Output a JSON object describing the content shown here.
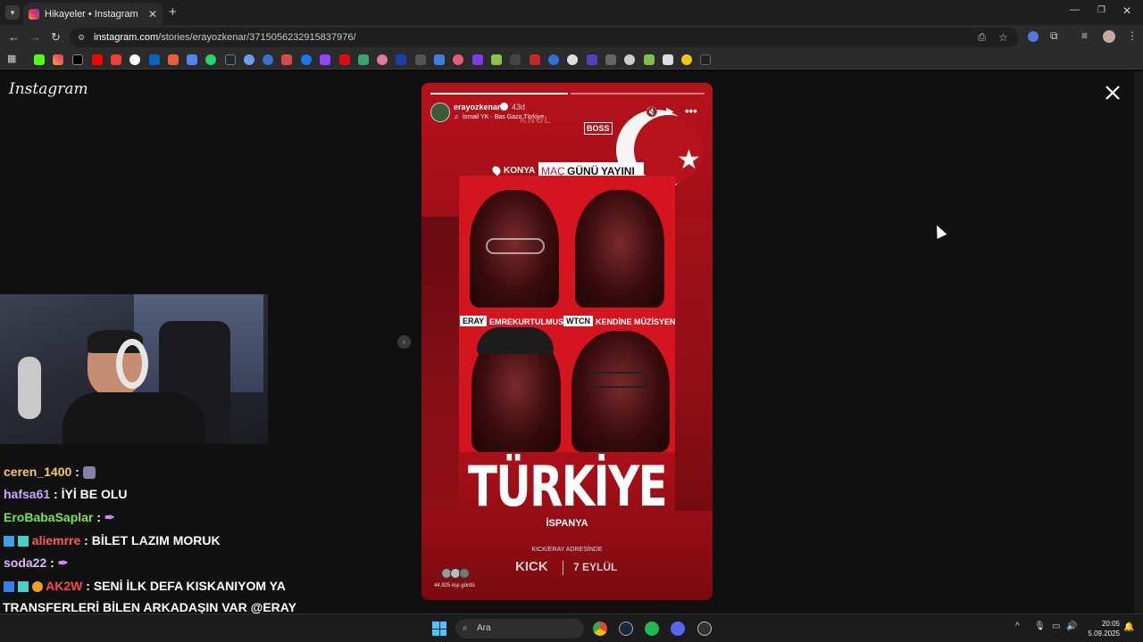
{
  "browser": {
    "tab_title": "Hikayeler • Instagram",
    "url_domain": "instagram.com",
    "url_path": "/stories/erayozkenar/3715056232915837976/"
  },
  "instagram": {
    "logo_text": "Instagram",
    "story": {
      "username": "erayozkenar",
      "age": "43d",
      "music": "İsmail YK · Bas Gaza Türkiye",
      "location_tag": "KONYA",
      "banner_word1": "MAÇ",
      "banner_word2": "GÜNÜ",
      "banner_word3": "YAYINI",
      "tag_eray": "ERAY",
      "tag_emre": "EMREKURTULMUS",
      "tag_wtcn": "WTCN",
      "tag_kendine": "KENDİNE MÜZİSYEN",
      "headline": "TÜRKİYE",
      "subheadline": "İSPANYA",
      "adres_line": "KICK/ERAY ADRESİNDE",
      "kick_label": "KICK",
      "date_label": "7 EYLÜL",
      "viewers": "44.925 kişi gördü",
      "logo_left": "KNGL",
      "logo_right": "BOSS"
    }
  },
  "chat": [
    {
      "user": "ceren_1400",
      "color": "#f6c76a",
      "message": ""
    },
    {
      "user": "hafsa61",
      "color": "#c9a8ff",
      "message": "İYİ BE OLU"
    },
    {
      "user": "EroBabaSaplar",
      "color": "#78e35a",
      "message": ""
    },
    {
      "user": "aliemrre",
      "color": "#ff5a5a",
      "message": "BİLET LAZIM MORUK"
    },
    {
      "user": "soda22",
      "color": "#e0b3ff",
      "message": ""
    },
    {
      "user": "AK2W",
      "color": "#ff4a4a",
      "message": "SENİ İLK DEFA KISKANIYOM YA"
    },
    {
      "user": "",
      "color": "#ffffff",
      "message": "TRANSFERLERİ BİLEN ARKADAŞIN VAR @ERAY"
    }
  ],
  "taskbar": {
    "search_placeholder": "Ara",
    "time": "20:05",
    "date": "5.09.2025"
  }
}
